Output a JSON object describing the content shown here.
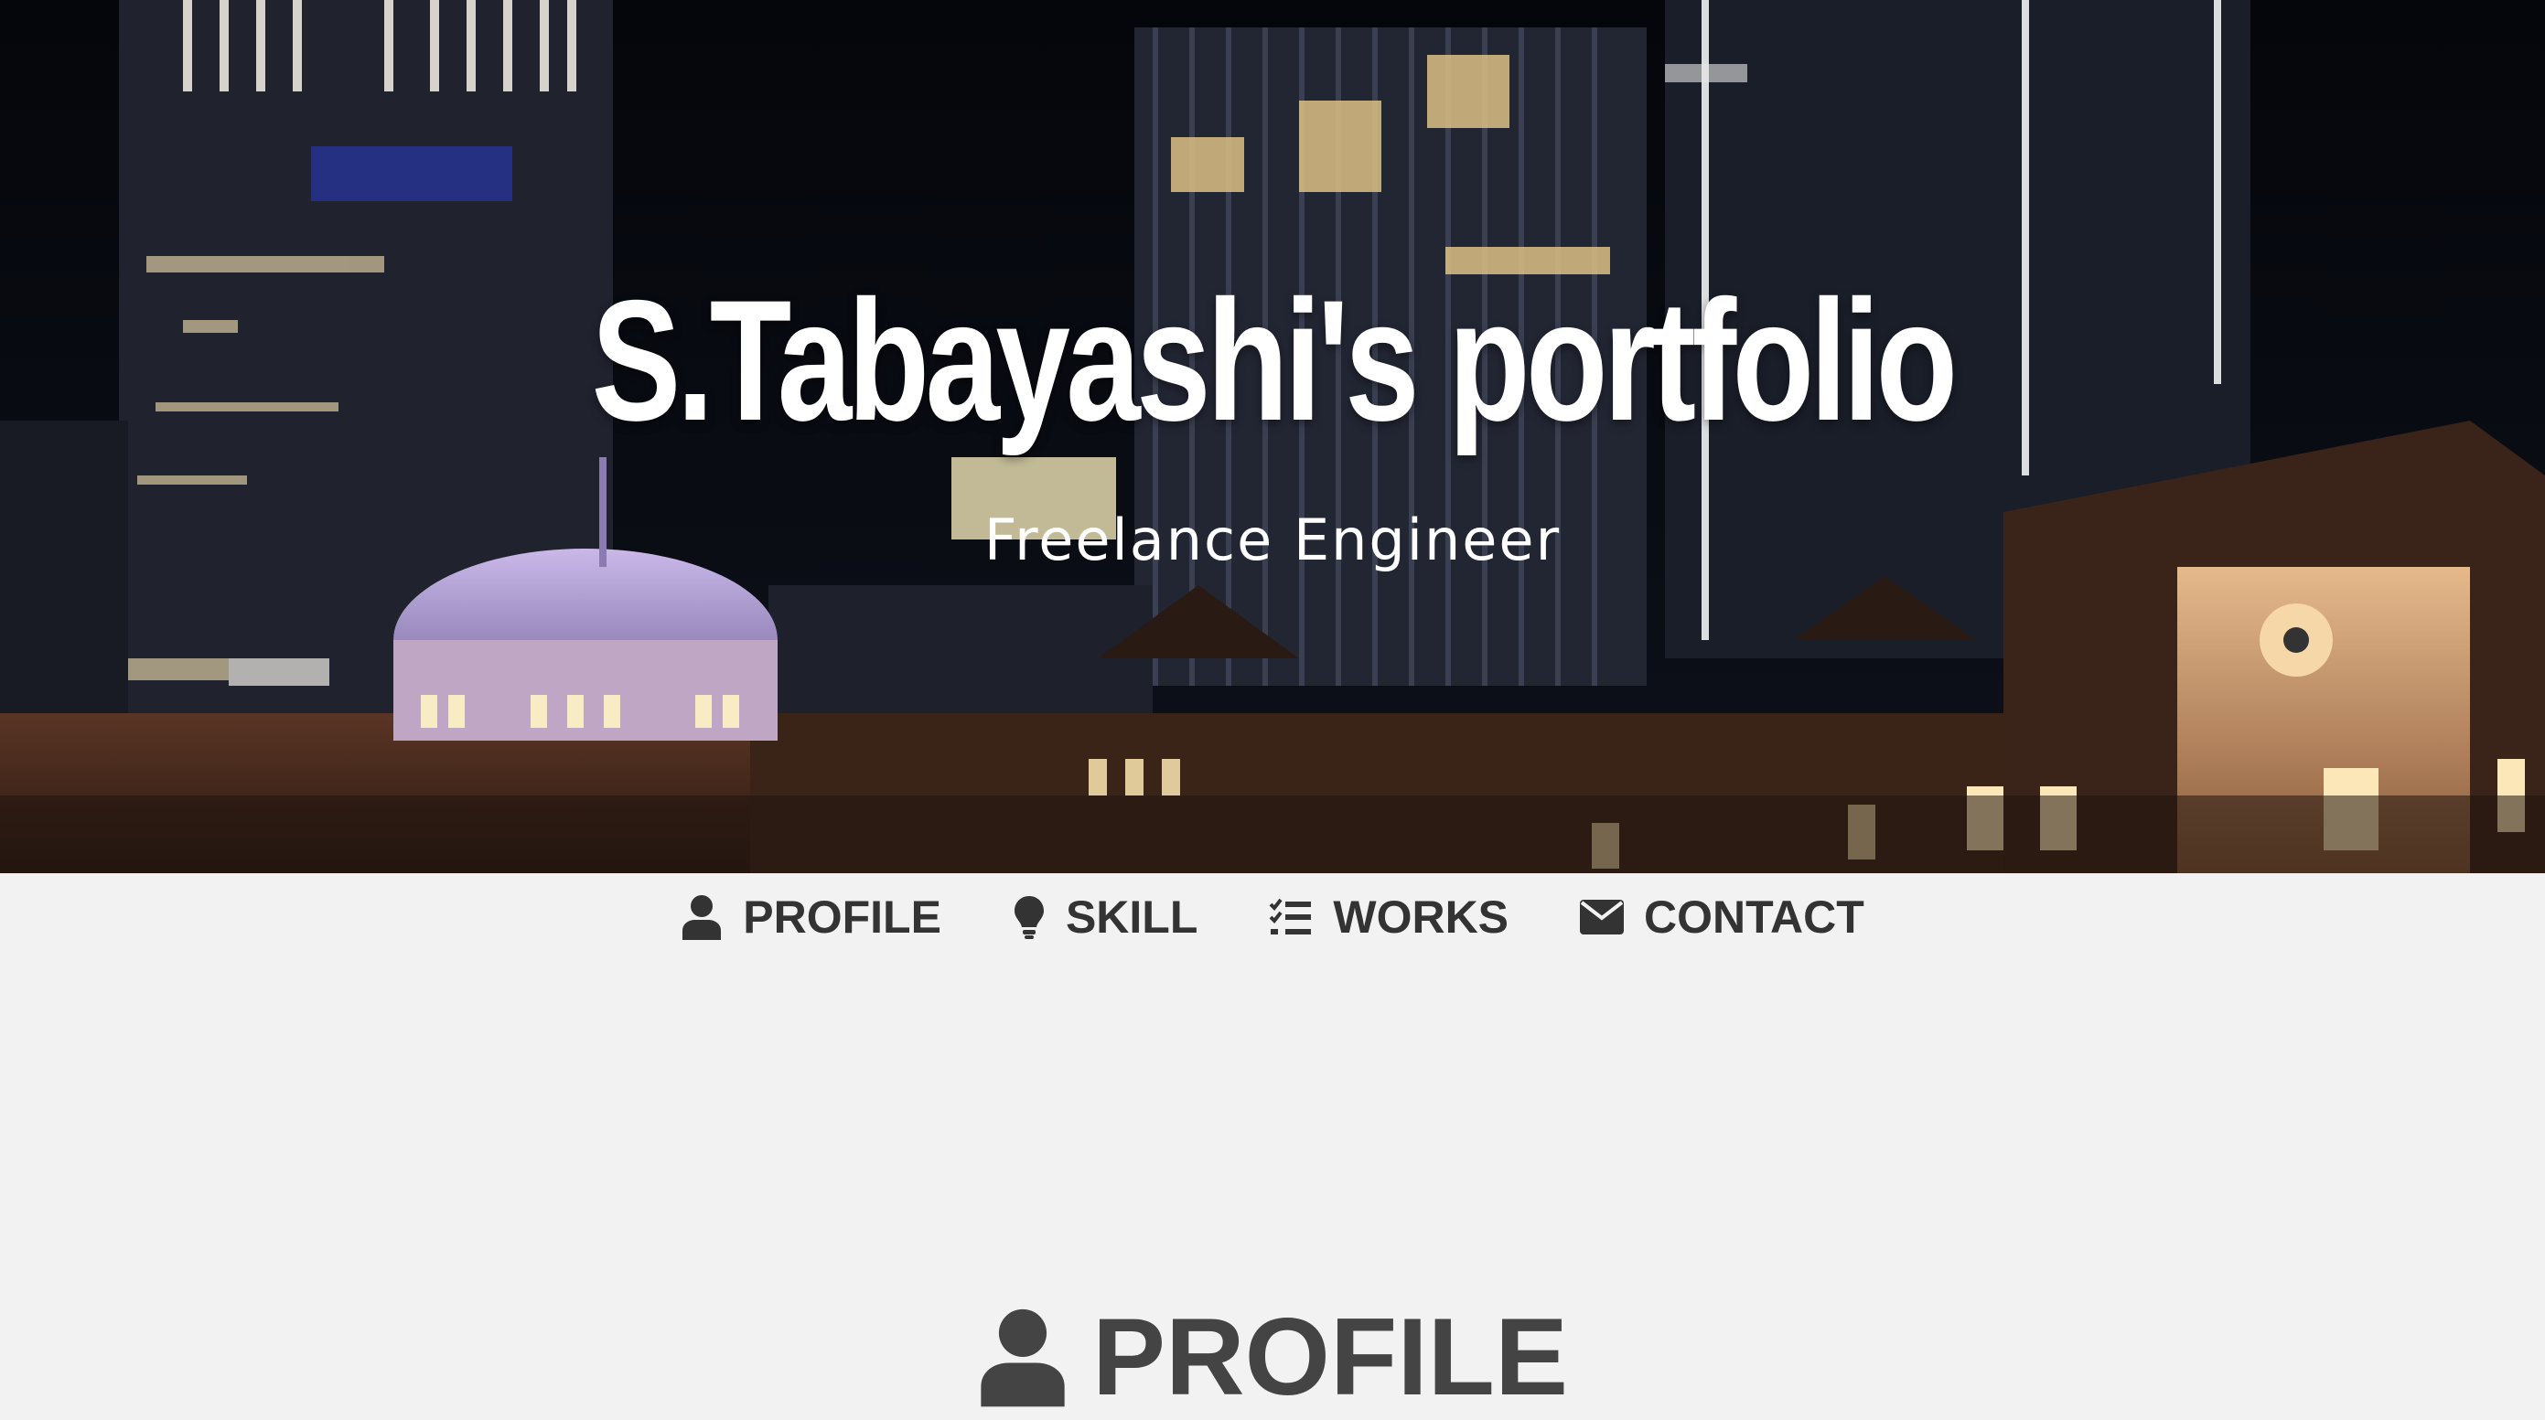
{
  "hero": {
    "title": "S.Tabayashi's portfolio",
    "subtitle": "Freelance Engineer",
    "background": "night-city-station-photo"
  },
  "nav": {
    "items": [
      {
        "label": "PROFILE",
        "icon": "user-icon"
      },
      {
        "label": "SKILL",
        "icon": "lightbulb-icon"
      },
      {
        "label": "WORKS",
        "icon": "list-check-icon"
      },
      {
        "label": "CONTACT",
        "icon": "envelope-icon"
      }
    ]
  },
  "section": {
    "title": "PROFILE",
    "icon": "user-icon"
  },
  "colors": {
    "page_bg": "#f2f2f2",
    "nav_text": "#333333",
    "section_text": "#444444",
    "hero_text": "#ffffff"
  }
}
